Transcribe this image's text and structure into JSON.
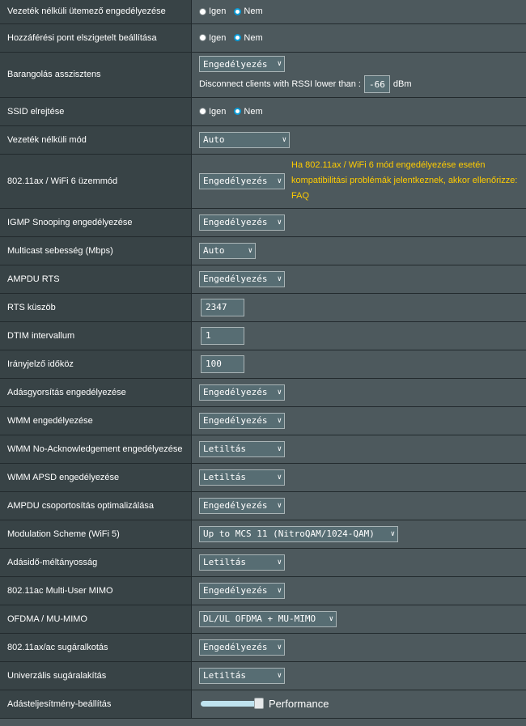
{
  "rows": {
    "scheduler": {
      "label": "Vezeték nélküli ütemező engedélyezése",
      "opt1": "Igen",
      "opt2": "Nem"
    },
    "ap_isolation": {
      "label": "Hozzáférési pont elszigetelt beállítása",
      "opt1": "Igen",
      "opt2": "Nem"
    },
    "roaming": {
      "label": "Barangolás asszisztens",
      "select": "Engedélyezés",
      "rssi_text": "Disconnect clients with RSSI lower than :",
      "rssi_value": "-66",
      "rssi_unit": "dBm"
    },
    "ssid_hide": {
      "label": "SSID elrejtése",
      "opt1": "Igen",
      "opt2": "Nem"
    },
    "wireless_mode": {
      "label": "Vezeték nélküli mód",
      "select": "Auto"
    },
    "wifi6_mode": {
      "label": "802.11ax / WiFi 6 üzemmód",
      "select": "Engedélyezés",
      "warning_line1": "Ha 802.11ax / WiFi 6 mód engedélyezése esetén",
      "warning_line2": "kompatibilitási problémák jelentkeznek, akkor ellenőrizze:",
      "warning_faq": "FAQ"
    },
    "igmp": {
      "label": "IGMP Snooping engedélyezése",
      "select": "Engedélyezés"
    },
    "multicast": {
      "label": "Multicast sebesség (Mbps)",
      "select": "Auto"
    },
    "ampdu_rts": {
      "label": "AMPDU RTS",
      "select": "Engedélyezés"
    },
    "rts": {
      "label": "RTS küszöb",
      "value": "2347"
    },
    "dtim": {
      "label": "DTIM intervallum",
      "value": "1"
    },
    "beacon": {
      "label": "Irányjelző időköz",
      "value": "100"
    },
    "tx_burst": {
      "label": "Adásgyorsítás engedélyezése",
      "select": "Engedélyezés"
    },
    "wmm": {
      "label": "WMM engedélyezése",
      "select": "Engedélyezés"
    },
    "wmm_noack": {
      "label": "WMM No-Acknowledgement engedélyezése",
      "select": "Letiltás"
    },
    "wmm_apsd": {
      "label": "WMM APSD engedélyezése",
      "select": "Letiltás"
    },
    "ampdu_agg": {
      "label": "AMPDU csoportosítás optimalizálása",
      "select": "Engedélyezés"
    },
    "modulation": {
      "label": "Modulation Scheme (WiFi 5)",
      "select": "Up to MCS 11 (NitroQAM/1024-QAM)"
    },
    "airtime": {
      "label": "Adásidő-méltányosság",
      "select": "Letiltás"
    },
    "mu_mimo": {
      "label": "802.11ac Multi-User MIMO",
      "select": "Engedélyezés"
    },
    "ofdma": {
      "label": "OFDMA / MU-MIMO",
      "select": "DL/UL OFDMA + MU-MIMO"
    },
    "beamforming": {
      "label": "802.11ax/ac sugáralkotás",
      "select": "Engedélyezés"
    },
    "univ_beam": {
      "label": "Univerzális sugáralakítás",
      "select": "Letiltás"
    },
    "tx_power": {
      "label": "Adásteljesítmény-beállítás",
      "slider_text": "Performance",
      "level": 1.0
    }
  },
  "colors": {
    "accent": "#0b9bd6",
    "warning": "#ffcc00",
    "label_bg": "#384346",
    "value_bg": "#4d595d"
  }
}
